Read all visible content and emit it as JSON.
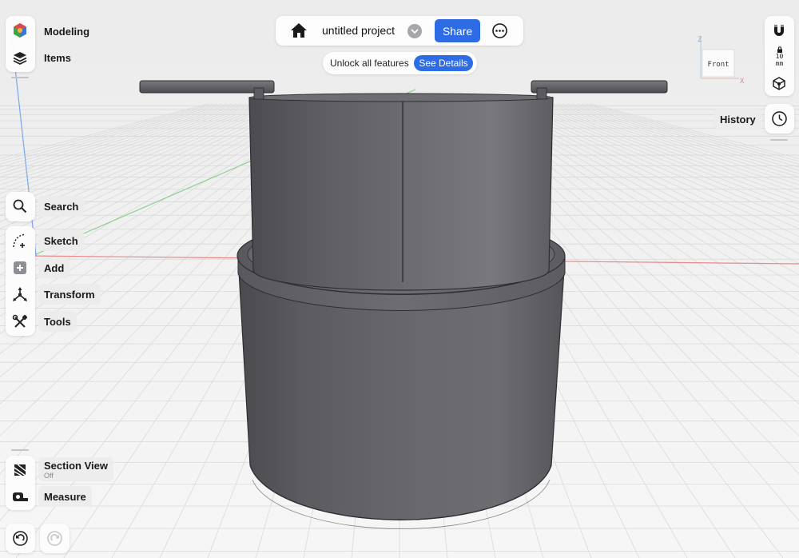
{
  "left_toolbar": {
    "modeling": "Modeling",
    "items": "Items",
    "search": "Search",
    "sketch": "Sketch",
    "add": "Add",
    "transform": "Transform",
    "tools": "Tools",
    "section_view": "Section View",
    "section_view_state": "Off",
    "measure": "Measure"
  },
  "top_bar": {
    "project_title": "untitled project",
    "share_label": "Share"
  },
  "promo": {
    "text": "Unlock all features",
    "button_label": "See Details"
  },
  "view_cube": {
    "face_label": "Front",
    "axis_z": "Z",
    "axis_x": "X"
  },
  "right_toolbar": {
    "grid_size": "10",
    "grid_unit": "mm",
    "history": "History"
  },
  "icons": {
    "home": "home-icon",
    "dropdown": "chevron-down-icon",
    "more": "ellipsis-icon",
    "magnet": "magnet-icon",
    "lock": "lock-icon",
    "cube": "cube-icon",
    "clock": "clock-icon",
    "undo": "undo-icon",
    "redo": "redo-icon"
  },
  "colors": {
    "accent": "#2e6ce6",
    "model": "#5c5c62",
    "axis_x": "#e06666",
    "axis_y": "#6cc06c",
    "axis_z": "#6a9ae8"
  }
}
